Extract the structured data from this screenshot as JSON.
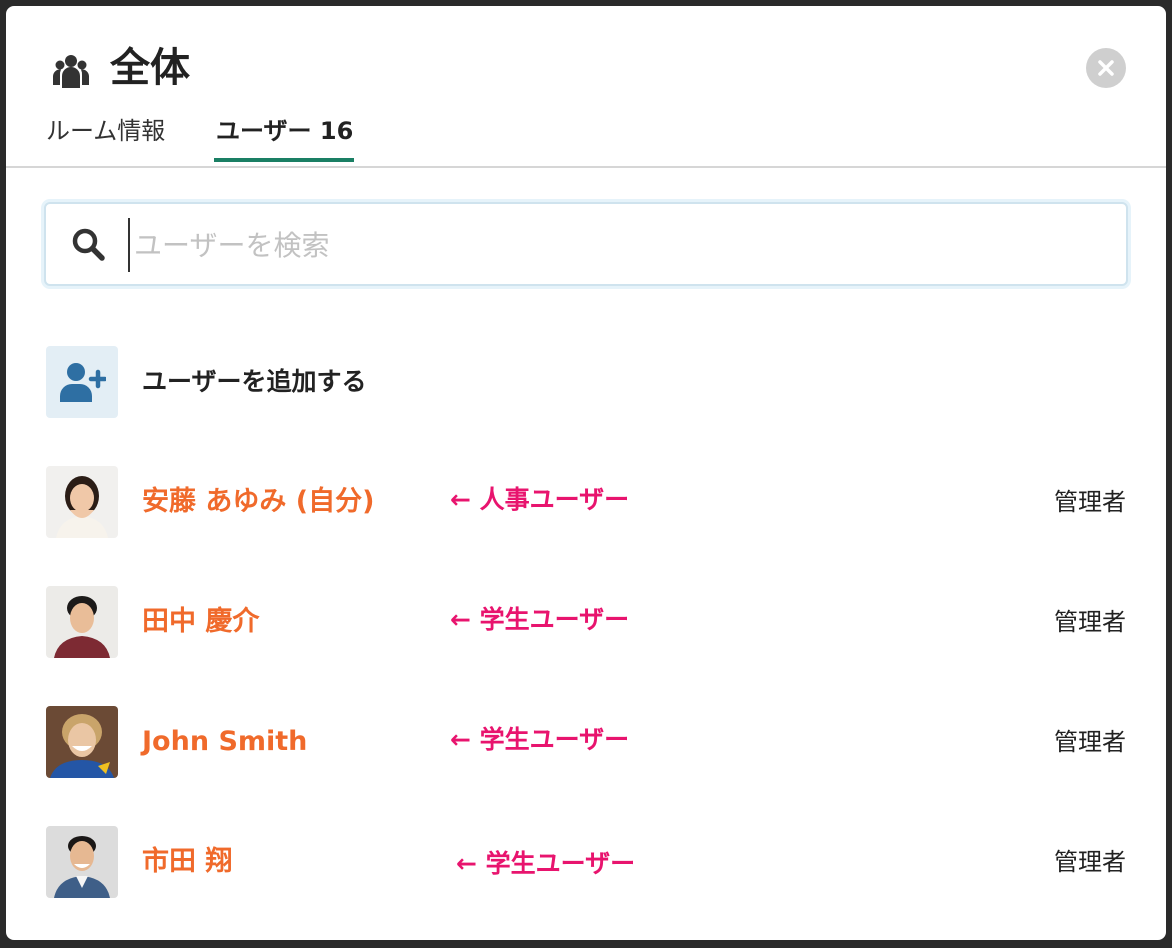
{
  "header": {
    "room_icon": "group-icon",
    "title": "全体",
    "close_icon": "close-icon"
  },
  "tabs": [
    {
      "label": "ルーム情報",
      "active": false
    },
    {
      "label": "ユーザー 16",
      "active": true
    }
  ],
  "accent_color": "#1a7f64",
  "search": {
    "icon": "search-icon",
    "placeholder": "ユーザーを検索",
    "value": ""
  },
  "add_user": {
    "icon": "add-user-icon",
    "label": "ユーザーを追加する"
  },
  "name_color": "#f06a2b",
  "annotation_color": "#e8146e",
  "users": [
    {
      "name": "安藤 あゆみ (自分)",
      "annotation": "← 人事ユーザー",
      "role": "管理者"
    },
    {
      "name": "田中 慶介",
      "annotation": "← 学生ユーザー",
      "role": "管理者"
    },
    {
      "name": "John Smith",
      "annotation": "← 学生ユーザー",
      "role": "管理者"
    },
    {
      "name": "市田 翔",
      "annotation": "← 学生ユーザー",
      "role": "管理者"
    }
  ]
}
